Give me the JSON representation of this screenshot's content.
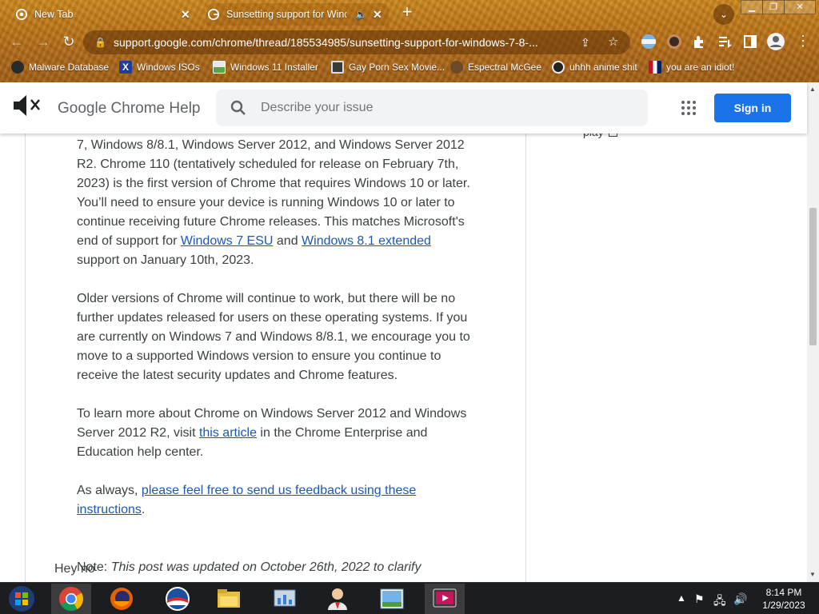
{
  "browser": {
    "tabs": [
      {
        "title": "New Tab"
      },
      {
        "title": "Sunsetting support for Windows"
      }
    ],
    "url": "support.google.com/chrome/thread/185534985/sunsetting-support-for-windows-7-8-...",
    "bookmarks": [
      {
        "label": "Malware Database"
      },
      {
        "label": "Windows ISOs"
      },
      {
        "label": "Windows 11 Installer"
      },
      {
        "label": "Gay Porn Sex Movie..."
      },
      {
        "label": "Espectral McGee"
      },
      {
        "label": "uhhh anime shit"
      },
      {
        "label": "you are an idiot!"
      }
    ]
  },
  "header": {
    "brand": "Google Chrome Help",
    "search_placeholder": "Describe your issue",
    "signin_label": "Sign in"
  },
  "sidebar": {
    "play_label": "play"
  },
  "article": {
    "p1": {
      "text_a": "7, Windows 8/8.1, Windows Server 2012, and Windows Server 2012 R2.  Chrome 110 (tentatively scheduled for release on February 7th, 2023) is the first version of Chrome that requires Windows 10 or later. You’ll need to ensure your device is running Windows 10 or later to continue receiving future Chrome releases. This matches Microsoft's end of support for ",
      "link1": "Windows 7 ESU",
      "text_b": " and ",
      "link2": "Windows 8.1 extended",
      "text_c": " support on January 10th, 2023."
    },
    "p2": "Older versions of Chrome will continue to work, but there will be no further updates released for users on these operating systems. If you are currently on Windows 7 and Windows 8/8.1, we encourage you to move to a supported Windows version to ensure you continue to receive the latest security updates and Chrome features.",
    "p3": {
      "text_a": "To learn more about Chrome on Windows Server 2012 and Windows Server 2012 R2, visit ",
      "link": "this article",
      "text_b": " in the Chrome Enterprise and Education help center."
    },
    "p4": {
      "text_a": "As always, ",
      "link": "please feel free to send us feedback using these instructions",
      "text_b": "."
    },
    "note": {
      "label": "Note:",
      "text": "This post was updated on October 26th, 2022 to clarify"
    },
    "overlay": "Hey no"
  },
  "taskbar": {
    "apps": [
      {
        "icon": "windows-start-icon"
      },
      {
        "icon": "chrome-icon"
      },
      {
        "icon": "firefox-icon"
      },
      {
        "icon": "obama-logo-icon"
      },
      {
        "icon": "file-explorer-icon"
      },
      {
        "icon": "control-panel-icon"
      },
      {
        "icon": "user-agent-icon"
      },
      {
        "icon": "photo-viewer-icon"
      },
      {
        "icon": "media-player-icon"
      }
    ],
    "time": "8:14 PM",
    "date": "1/29/2023"
  },
  "colors": {
    "accent": "#1a73e8",
    "link": "#1a57b6",
    "theme": "#b9741a",
    "taskbar": "#1c1d20"
  }
}
